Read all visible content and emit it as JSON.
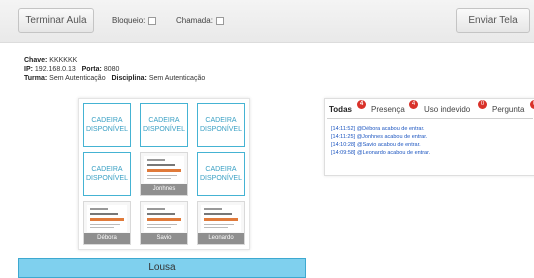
{
  "toolbar": {
    "end_class_label": "Terminar Aula",
    "lock_label": "Bloqueio:",
    "call_label": "Chamada:",
    "send_screen_label": "Enviar Tela"
  },
  "info": {
    "key_label": "Chave:",
    "key_value": "KKKKKK",
    "ip_label": "IP:",
    "ip_value": "192.168.0.13",
    "port_label": "Porta:",
    "port_value": "8080",
    "class_label": "Turma:",
    "class_value": "Sem Autenticação",
    "subject_label": "Disciplina:",
    "subject_value": "Sem Autenticação"
  },
  "seats": {
    "available_line1": "CADEIRA",
    "available_line2": "DISPONÍVEL",
    "occupied": [
      "Jonhnes",
      "Débora",
      "Savio",
      "Leonardo"
    ]
  },
  "board_label": "Lousa",
  "tabs": [
    {
      "label": "Todas",
      "count": "4"
    },
    {
      "label": "Presença",
      "count": "4"
    },
    {
      "label": "Uso indevido",
      "count": "0"
    },
    {
      "label": "Pergunta",
      "count": "0"
    }
  ],
  "log": [
    "[14:11:52] @Débora   acabou de entrar.",
    "[14:11:25] @Jonhnes  acabou de entrar.",
    "[14:10:28] @Savio    acabou de entrar.",
    "[14:09:58] @Leonardo acabou de entrar."
  ],
  "colors": {
    "seat_border": "#45b3d3",
    "board_fill": "#7fd0ee",
    "badge": "#d9322a",
    "log_text": "#1d56c0"
  }
}
